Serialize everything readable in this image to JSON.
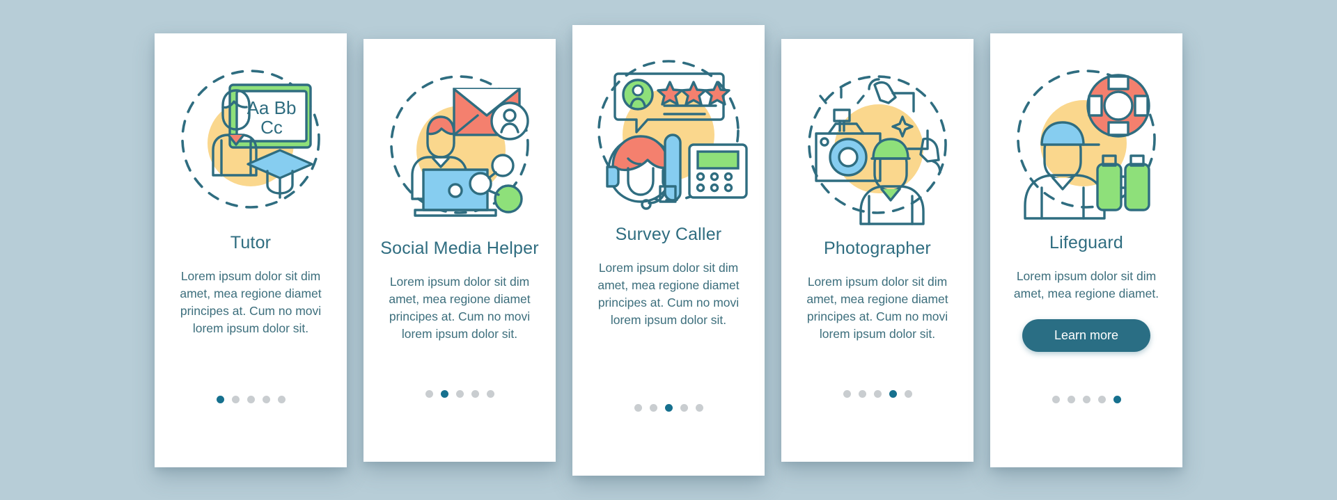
{
  "palette": {
    "background": "#b7cdd7",
    "card": "#ffffff",
    "teal": "#2f6d80",
    "teal_dark": "#2a6e84",
    "yellow": "#fad78d",
    "coral": "#f4806e",
    "blue": "#86cdf0",
    "green": "#8ee07a",
    "dot_inactive": "#c9cdd0",
    "dot_active": "#16708e"
  },
  "screens": [
    {
      "id": "tutor",
      "illustration": "tutor-illustration",
      "title": "Tutor",
      "body": "Lorem ipsum dolor sit dim amet, mea regione diamet principes at. Cum no movi lorem ipsum dolor sit.",
      "dots": {
        "total": 5,
        "active": 1
      },
      "button": null
    },
    {
      "id": "social-media-helper",
      "illustration": "social-media-helper-illustration",
      "title": "Social Media Helper",
      "body": "Lorem ipsum dolor sit dim amet, mea regione diamet principes at. Cum no movi lorem ipsum dolor sit.",
      "dots": {
        "total": 5,
        "active": 2
      },
      "button": null
    },
    {
      "id": "survey-caller",
      "illustration": "survey-caller-illustration",
      "title": "Survey Caller",
      "body": "Lorem ipsum dolor sit dim amet, mea regione diamet principes at. Cum no movi lorem ipsum dolor sit.",
      "dots": {
        "total": 5,
        "active": 3
      },
      "button": null
    },
    {
      "id": "photographer",
      "illustration": "photographer-illustration",
      "title": "Photographer",
      "body": "Lorem ipsum dolor sit dim amet, mea regione diamet principes at. Cum no movi lorem ipsum dolor sit.",
      "dots": {
        "total": 5,
        "active": 4
      },
      "button": null
    },
    {
      "id": "lifeguard",
      "illustration": "lifeguard-illustration",
      "title": "Lifeguard",
      "body": "Lorem ipsum dolor sit dim amet, mea regione diamet.",
      "dots": {
        "total": 5,
        "active": 5
      },
      "button": {
        "label": "Learn more"
      }
    }
  ]
}
